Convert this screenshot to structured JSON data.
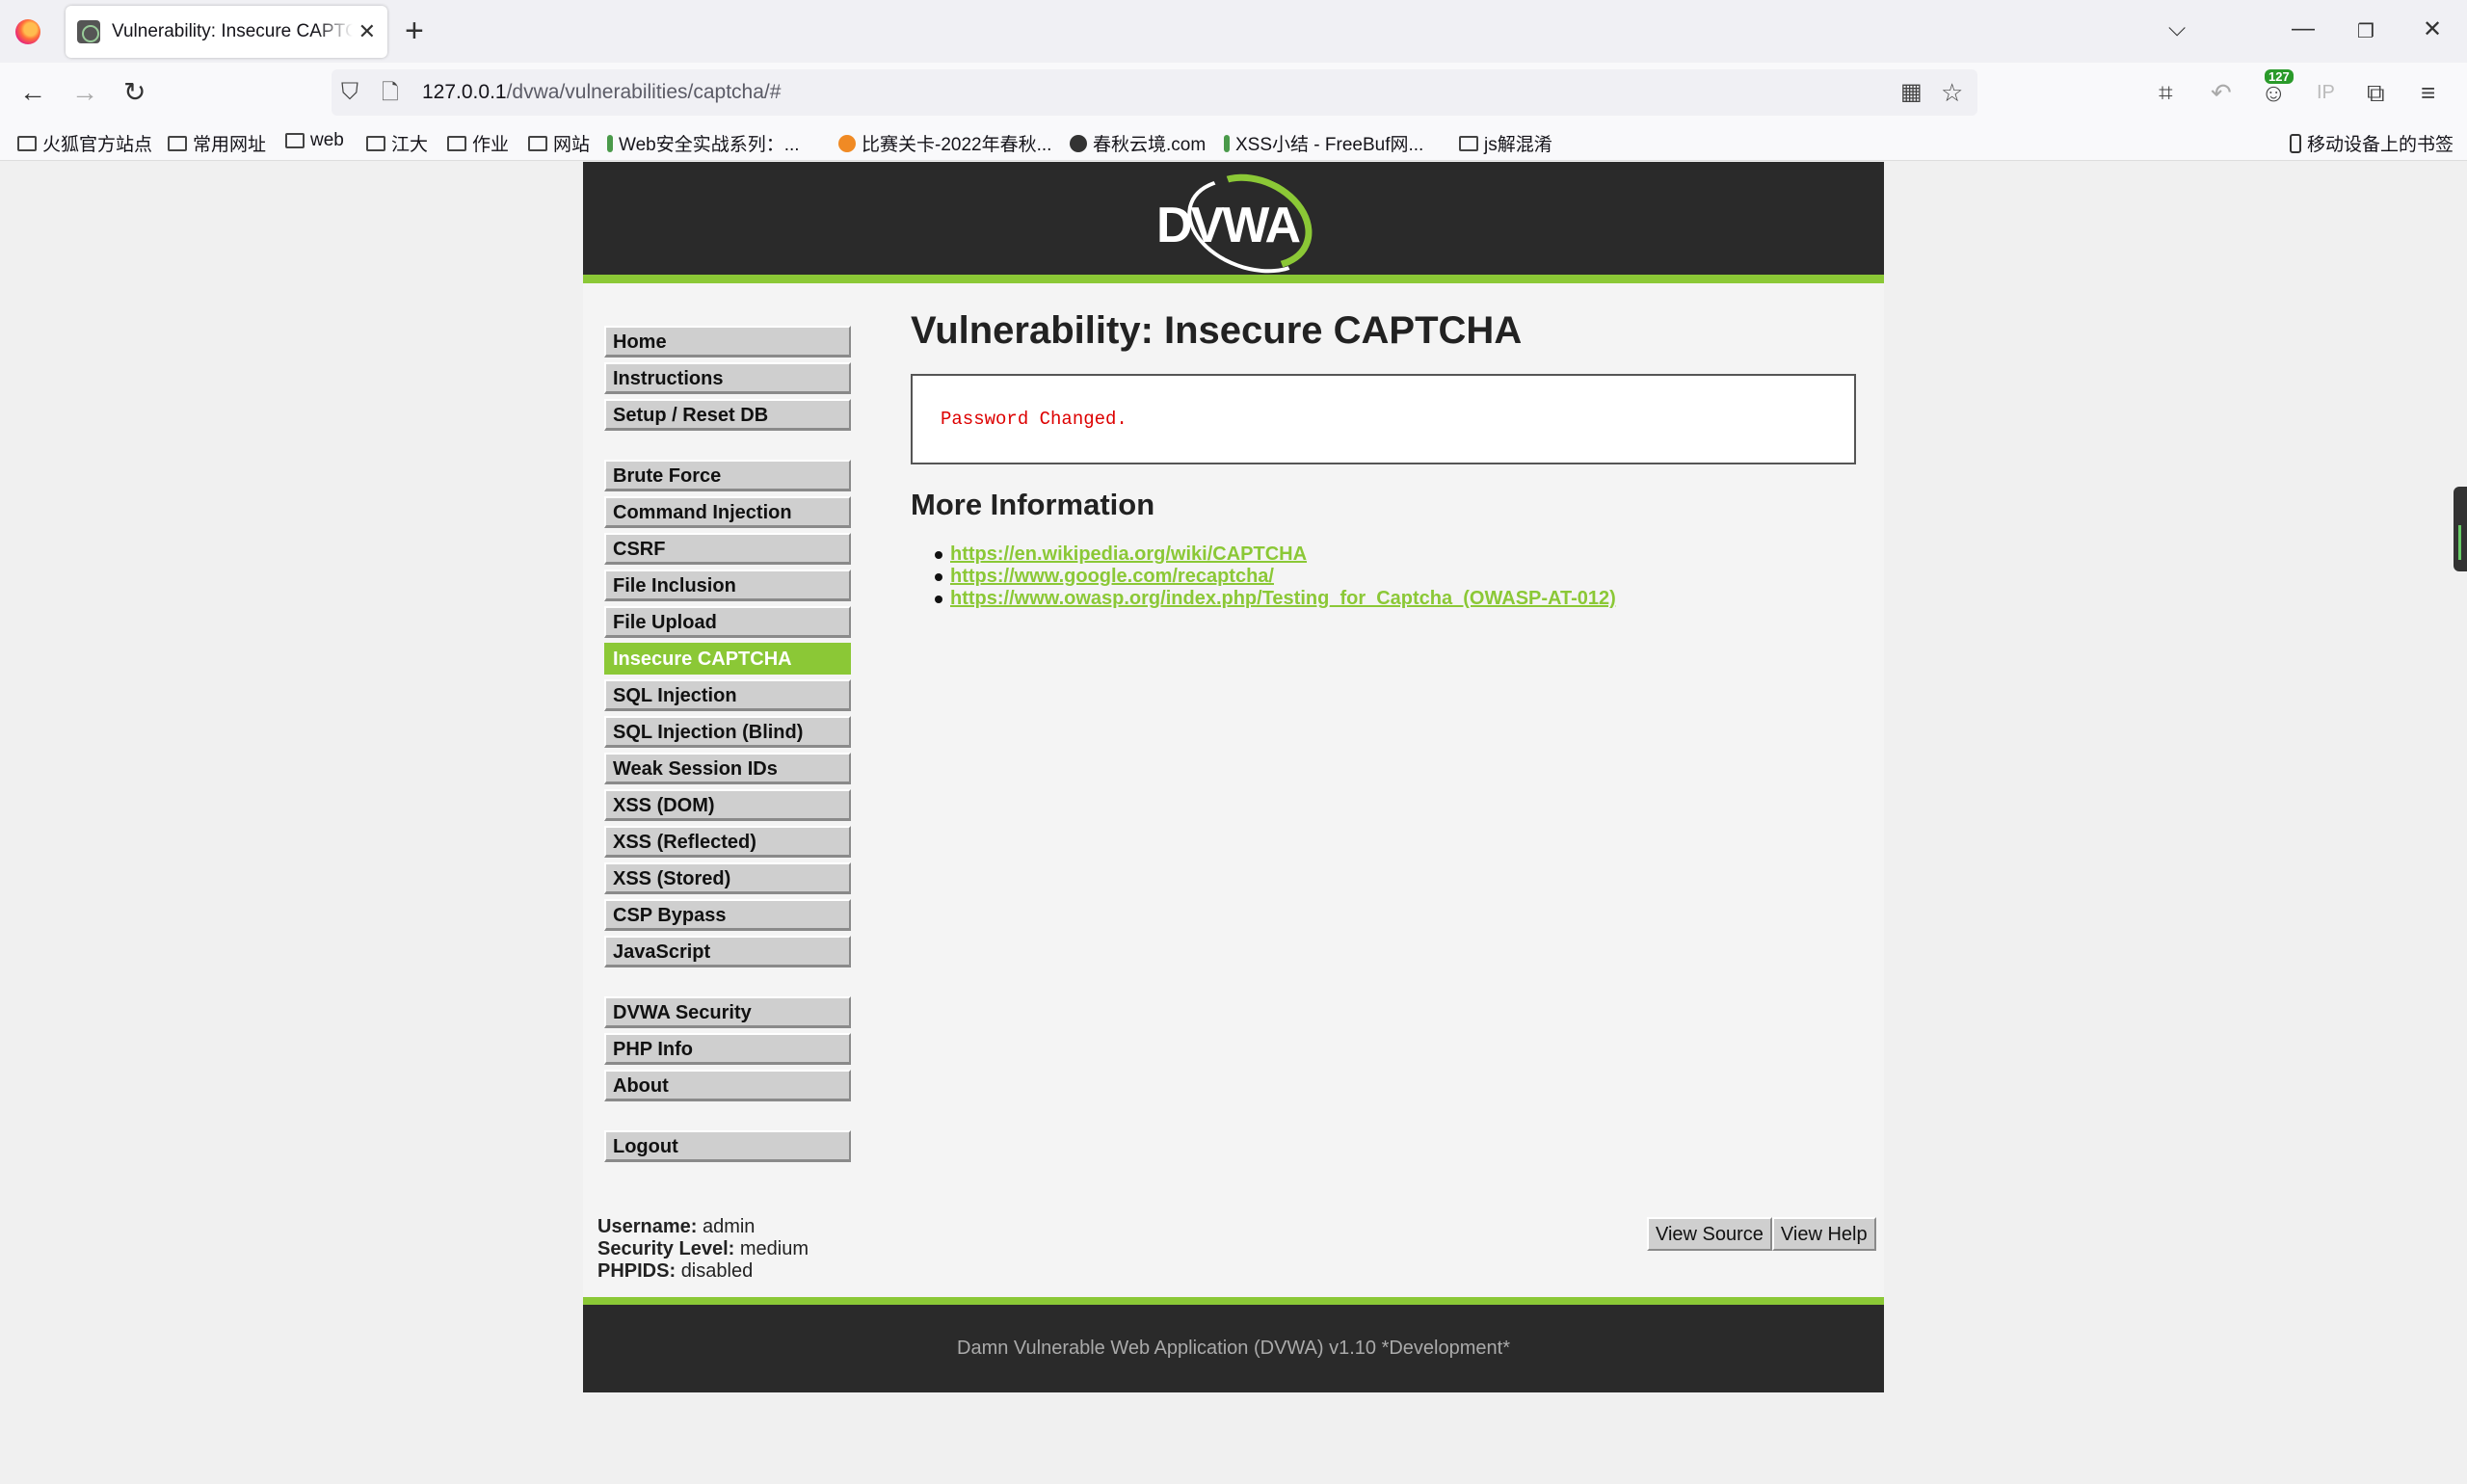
{
  "browser": {
    "tab_title": "Vulnerability: Insecure CAPTCHA :: Damn Vulnerable Web Application (DVWA)",
    "url_host": "127.0.0.1",
    "url_path": "/dvwa/vulnerabilities/captcha/#",
    "badge_count": "127",
    "bookmarks": [
      {
        "label": "火狐官方站点",
        "icon": "folder-icon"
      },
      {
        "label": "常用网址",
        "icon": "folder-icon"
      },
      {
        "label": "web",
        "icon": "folder-icon"
      },
      {
        "label": "江大",
        "icon": "folder-icon"
      },
      {
        "label": "作业",
        "icon": "folder-icon"
      },
      {
        "label": "网站",
        "icon": "folder-icon"
      },
      {
        "label": "Web安全实战系列：...",
        "icon": "favicon"
      },
      {
        "label": "比赛关卡-2022年春秋...",
        "icon": "favicon"
      },
      {
        "label": "春秋云境.com",
        "icon": "favicon"
      },
      {
        "label": "XSS小结 - FreeBuf网...",
        "icon": "favicon"
      },
      {
        "label": "js解混淆",
        "icon": "folder-icon"
      }
    ],
    "mobile_bookmarks": "移动设备上的书签"
  },
  "dvwa": {
    "logo_text": "DVWA",
    "menu": {
      "group1": [
        "Home",
        "Instructions",
        "Setup / Reset DB"
      ],
      "group2": [
        "Brute Force",
        "Command Injection",
        "CSRF",
        "File Inclusion",
        "File Upload",
        "Insecure CAPTCHA",
        "SQL Injection",
        "SQL Injection (Blind)",
        "Weak Session IDs",
        "XSS (DOM)",
        "XSS (Reflected)",
        "XSS (Stored)",
        "CSP Bypass",
        "JavaScript"
      ],
      "group3": [
        "DVWA Security",
        "PHP Info",
        "About"
      ],
      "group4": [
        "Logout"
      ],
      "active": "Insecure CAPTCHA"
    },
    "page_title": "Vulnerability: Insecure CAPTCHA",
    "message": "Password Changed.",
    "more_info_heading": "More Information",
    "links": [
      "https://en.wikipedia.org/wiki/CAPTCHA",
      "https://www.google.com/recaptcha/",
      "https://www.owasp.org/index.php/Testing_for_Captcha_(OWASP-AT-012)"
    ],
    "userinfo": {
      "username_label": "Username:",
      "username": "admin",
      "security_label": "Security Level:",
      "security": "medium",
      "phpids_label": "PHPIDS:",
      "phpids": "disabled"
    },
    "view_source": "View Source",
    "view_help": "View Help",
    "footer": "Damn Vulnerable Web Application (DVWA) v1.10 *Development*"
  },
  "colors": {
    "accent": "#8bc836",
    "header_bg": "#2a2a2a",
    "message_text": "#dd0000"
  }
}
